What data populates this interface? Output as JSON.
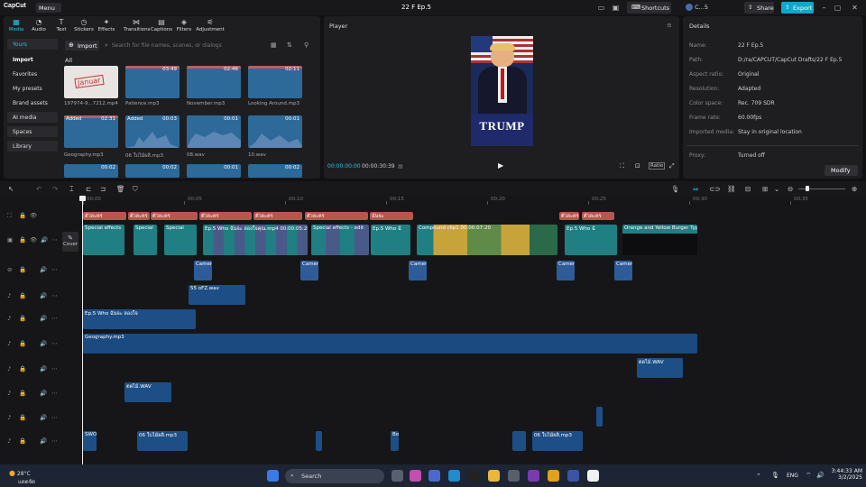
{
  "app": {
    "logo": "CapCut",
    "menu_label": "Menu",
    "title": "22 F Ep.5",
    "shortcuts_label": "Shortcuts",
    "user": "C...5",
    "share_label": "Share",
    "export_label": "Export"
  },
  "media_panel": {
    "tabs": [
      {
        "label": "Media",
        "icon": "media-icon"
      },
      {
        "label": "Audio",
        "icon": "audio-icon"
      },
      {
        "label": "Text",
        "icon": "text-icon"
      },
      {
        "label": "Stickers",
        "icon": "stickers-icon"
      },
      {
        "label": "Effects",
        "icon": "effects-icon"
      },
      {
        "label": "Transitions",
        "icon": "transitions-icon"
      },
      {
        "label": "Captions",
        "icon": "captions-icon"
      },
      {
        "label": "Filters",
        "icon": "filters-icon"
      },
      {
        "label": "Adjustment",
        "icon": "adjustment-icon"
      }
    ],
    "sidebar": [
      "Yours",
      "Import",
      "Favorites",
      "My presets",
      "Brand assets",
      "AI media",
      "Spaces",
      "Library"
    ],
    "import_label": "Import",
    "search_placeholder": "Search for file names, scenes, or dialogs",
    "filter_label": "All",
    "items": [
      {
        "name": "197974-9...7212.mp4",
        "duration": "",
        "added": false
      },
      {
        "name": "Patience.mp3",
        "duration": "03:49",
        "added": false
      },
      {
        "name": "November.mp3",
        "duration": "02:46",
        "added": false
      },
      {
        "name": "Looking Around.mp3",
        "duration": "02:11",
        "added": false
      },
      {
        "name": "Geography.mp3",
        "duration": "02:31",
        "added": true
      },
      {
        "name": "06 ใบไม้ผลิ.mp3",
        "duration": "00:03",
        "added": true
      },
      {
        "name": "08.wav",
        "duration": "00:01",
        "added": false
      },
      {
        "name": "10.wav",
        "duration": "00:01",
        "added": false
      },
      {
        "name": "",
        "duration": "00:02",
        "added": false
      },
      {
        "name": "",
        "duration": "00:02",
        "added": false
      },
      {
        "name": "",
        "duration": "00:01",
        "added": false
      },
      {
        "name": "",
        "duration": "00:02",
        "added": false
      }
    ],
    "thumb_text": "Januar"
  },
  "player": {
    "title": "Player",
    "current_time": "00:00:00:00",
    "total_time": "00:00:30:39",
    "ratio_label": "Ratio",
    "video_text": "TRUMP"
  },
  "details": {
    "title": "Details",
    "rows": [
      {
        "k": "Name:",
        "v": "22 F Ep.5"
      },
      {
        "k": "Path:",
        "v": "D:/ra/CAPCUT/CapCut Drafts/22 F Ep.5"
      },
      {
        "k": "Aspect ratio:",
        "v": "Original"
      },
      {
        "k": "Resolution:",
        "v": "Adapted"
      },
      {
        "k": "Color space:",
        "v": "Rec. 709 SDR"
      },
      {
        "k": "Frame rate:",
        "v": "60.00fps"
      },
      {
        "k": "Imported media:",
        "v": "Stay in original location"
      },
      {
        "k": "Proxy:",
        "v": "Turned off"
      }
    ],
    "modify_label": "Modify"
  },
  "timeline": {
    "ruler": [
      "00:00",
      "00:05",
      "00:10",
      "00:15",
      "00:20",
      "00:25",
      "00:30",
      "00:35"
    ],
    "cover_label": "Cover",
    "video_clips": [
      "Special effects",
      "Special",
      "Special",
      "Ep.5 Who ฉันจะ ลองใจคุณ.mp4  00:00:05:20",
      "Special effects - edit",
      "Ep.5 Who ฉั",
      "Compound clip1  00:00:07:20",
      "Ep.5 Who ฉั",
      "Orange and Yellow Burger Typ"
    ],
    "text_clips": [
      "ตัวละคร",
      "ตัวละคร",
      "ตัวละคร",
      "ตัวละคร",
      "ตัวละคร",
      "ตัวละคร",
      "ฉันจะ",
      "ตัวละคร",
      "ตัวละคร"
    ],
    "cam_label": "Camer",
    "audio_clips": {
      "ssofz": "55 oFZ.wav",
      "ep5": "Ep.5 Who ฉันจะ ลองใจ",
      "geography": "Geography.mp3",
      "wav1": "ตดไม้.WAV",
      "wav2": "ตดไม้.WAV",
      "swo": "SWO",
      "spring1": "06 ใบไม้ผลิ.mp3",
      "spring2": "06 ใบไม้ผลิ.mp3",
      "bo": "Bo"
    }
  },
  "taskbar": {
    "temp": "28°C",
    "weather": "แดดจัด",
    "search_label": "Search",
    "lang": "ENG",
    "time": "3:44:33 AM",
    "date": "3/2/2025"
  }
}
